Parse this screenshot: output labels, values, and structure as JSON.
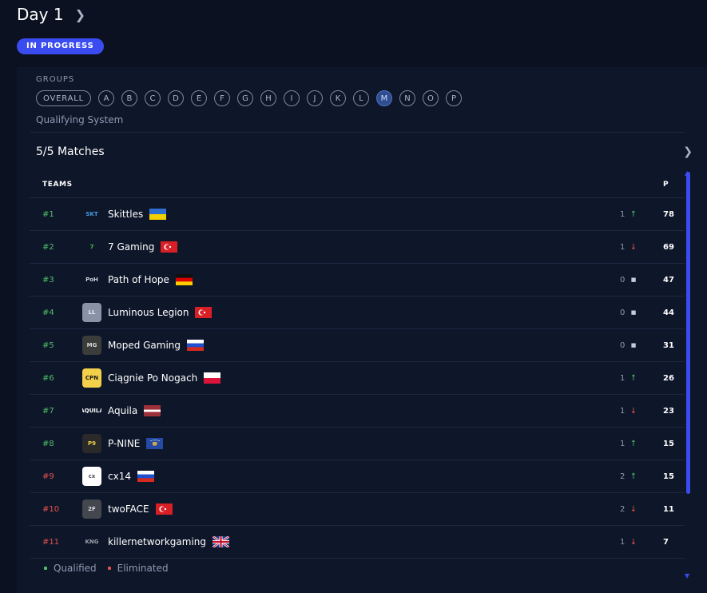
{
  "header": {
    "title": "Day 1",
    "status": "IN PROGRESS"
  },
  "groups": {
    "label": "GROUPS",
    "items": [
      "OVERALL",
      "A",
      "B",
      "C",
      "D",
      "E",
      "F",
      "G",
      "H",
      "I",
      "J",
      "K",
      "L",
      "M",
      "N",
      "O",
      "P"
    ],
    "active": "M",
    "qualifying_link": "Qualifying System"
  },
  "matches": {
    "title": "5/5 Matches"
  },
  "table": {
    "headers": {
      "teams": "TEAMS",
      "points": "P"
    },
    "rows": [
      {
        "rank": "#1",
        "status": "qualified",
        "name": "Skittles",
        "flag": "ukraine",
        "change": "1",
        "trend": "up",
        "points": "78",
        "logo": "SKT",
        "logo_bg": "#0e1629",
        "logo_fg": "#4a9be0"
      },
      {
        "rank": "#2",
        "status": "qualified",
        "name": "7 Gaming",
        "flag": "turkey",
        "change": "1",
        "trend": "down",
        "points": "69",
        "logo": "7",
        "logo_bg": "#0e1629",
        "logo_fg": "#3fbf4a"
      },
      {
        "rank": "#3",
        "status": "qualified",
        "name": "Path of Hope",
        "flag": "germany",
        "change": "0",
        "trend": "same",
        "points": "47",
        "logo": "PoH",
        "logo_bg": "#0e1629",
        "logo_fg": "#cfd4de"
      },
      {
        "rank": "#4",
        "status": "qualified",
        "name": "Luminous Legion",
        "flag": "turkey",
        "change": "0",
        "trend": "same",
        "points": "44",
        "logo": "LL",
        "logo_bg": "#8a93a6",
        "logo_fg": "#e9edf4"
      },
      {
        "rank": "#5",
        "status": "qualified",
        "name": "Moped Gaming",
        "flag": "russia",
        "change": "0",
        "trend": "same",
        "points": "31",
        "logo": "MG",
        "logo_bg": "#3a3d3a",
        "logo_fg": "#d7d9d7"
      },
      {
        "rank": "#6",
        "status": "qualified",
        "name": "Ciągnie Po Nogach",
        "flag": "poland",
        "change": "1",
        "trend": "up",
        "points": "26",
        "logo": "CPN",
        "logo_bg": "#f2d04a",
        "logo_fg": "#1b1b1b"
      },
      {
        "rank": "#7",
        "status": "qualified",
        "name": "Aquila",
        "flag": "latvia",
        "change": "1",
        "trend": "down",
        "points": "23",
        "logo": "AQUILA",
        "logo_bg": "#0e1629",
        "logo_fg": "#ffffff"
      },
      {
        "rank": "#8",
        "status": "qualified",
        "name": "P-NINE",
        "flag": "kosovo",
        "change": "1",
        "trend": "up",
        "points": "15",
        "logo": "P9",
        "logo_bg": "#2a2a2a",
        "logo_fg": "#f2d04a"
      },
      {
        "rank": "#9",
        "status": "eliminated",
        "name": "cx14",
        "flag": "russia",
        "change": "2",
        "trend": "up",
        "points": "15",
        "logo": "cx",
        "logo_bg": "#ffffff",
        "logo_fg": "#555555"
      },
      {
        "rank": "#10",
        "status": "eliminated",
        "name": "twoFACE",
        "flag": "turkey",
        "change": "2",
        "trend": "down",
        "points": "11",
        "logo": "2F",
        "logo_bg": "#44474d",
        "logo_fg": "#dfe2e8"
      },
      {
        "rank": "#11",
        "status": "eliminated",
        "name": "killernetworkgaming",
        "flag": "uk",
        "change": "1",
        "trend": "down",
        "points": "7",
        "logo": "KNG",
        "logo_bg": "#0e1629",
        "logo_fg": "#9aa0aa"
      }
    ]
  },
  "legend": {
    "qualified": "Qualified",
    "eliminated": "Eliminated"
  },
  "colors": {
    "accent": "#3a4cf0",
    "qualified": "#4fbf67",
    "eliminated": "#e2524a"
  }
}
